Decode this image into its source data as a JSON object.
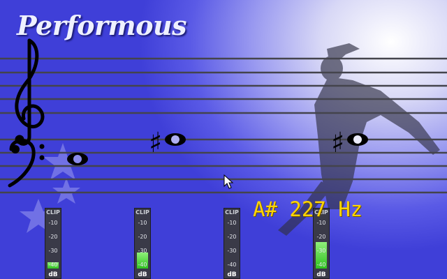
{
  "app": {
    "title": "Performous"
  },
  "colors": {
    "accent": "#ffd400",
    "meter_fill": "#3ed22c",
    "background": "#4b4be0"
  },
  "notes": [
    {
      "accidental": "",
      "icon": "whole-note-icon"
    },
    {
      "accidental": "♯",
      "icon": "whole-note-icon"
    },
    {
      "accidental": "♯",
      "icon": "whole-note-icon"
    }
  ],
  "pitch_readout": "A# 227 Hz",
  "meters": [
    {
      "clip": "CLIP",
      "ticks": [
        "-10",
        "-20",
        "-30",
        "-40"
      ],
      "unit": "dB",
      "level": 0.11
    },
    {
      "clip": "CLIP",
      "ticks": [
        "-10",
        "-20",
        "-30",
        "-40"
      ],
      "unit": "dB",
      "level": 0.27
    },
    {
      "clip": "CLIP",
      "ticks": [
        "-10",
        "-20",
        "-30",
        "-40"
      ],
      "unit": "dB",
      "level": 0
    },
    {
      "clip": "CLIP",
      "ticks": [
        "-10",
        "-20",
        "-30",
        "-40"
      ],
      "unit": "dB",
      "level": 0.45
    }
  ]
}
